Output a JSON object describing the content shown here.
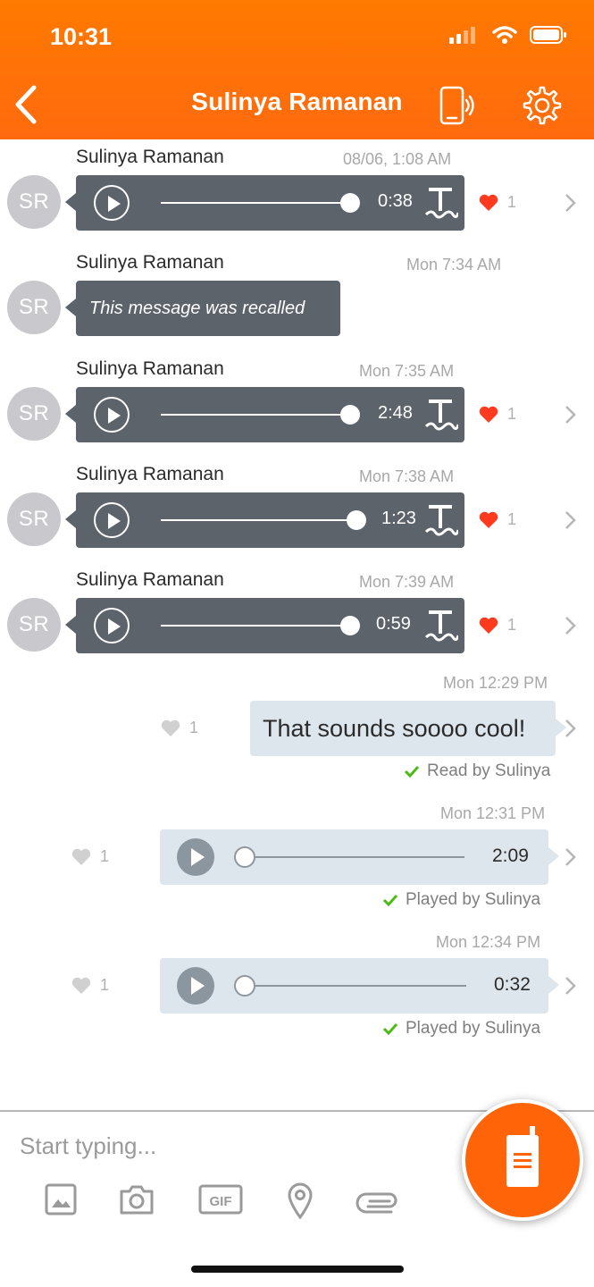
{
  "status_bar": {
    "time": "10:31"
  },
  "header": {
    "title": "Sulinya Ramanan"
  },
  "messages": [
    {
      "sender": "Sulinya Ramanan",
      "avatar": "SR",
      "timestamp": "08/06, 1:08 AM",
      "duration": "0:38",
      "likes": "1"
    },
    {
      "sender": "Sulinya Ramanan",
      "avatar": "SR",
      "timestamp": "Mon 7:34 AM",
      "text": "This message was recalled"
    },
    {
      "sender": "Sulinya Ramanan",
      "avatar": "SR",
      "timestamp": "Mon 7:35 AM",
      "duration": "2:48",
      "likes": "1"
    },
    {
      "sender": "Sulinya Ramanan",
      "avatar": "SR",
      "timestamp": "Mon 7:38 AM",
      "duration": "1:23",
      "likes": "1"
    },
    {
      "sender": "Sulinya Ramanan",
      "avatar": "SR",
      "timestamp": "Mon 7:39 AM",
      "duration": "0:59",
      "likes": "1"
    },
    {
      "timestamp": "Mon 12:29 PM",
      "text": "That sounds soooo cool!",
      "likes": "1",
      "status": "Read by Sulinya"
    },
    {
      "timestamp": "Mon 12:31 PM",
      "duration": "2:09",
      "likes": "1",
      "status": "Played by Sulinya"
    },
    {
      "timestamp": "Mon 12:34 PM",
      "duration": "0:32",
      "likes": "1",
      "status": "Played by Sulinya"
    }
  ],
  "composer": {
    "placeholder": "Start typing..."
  },
  "colors": {
    "header": "#ff7a00",
    "accent": "#ff6508",
    "bubble_dark": "#5c636b",
    "bubble_light": "#dde6ed",
    "heart": "#ff3a1f",
    "check": "#4cbb17"
  }
}
